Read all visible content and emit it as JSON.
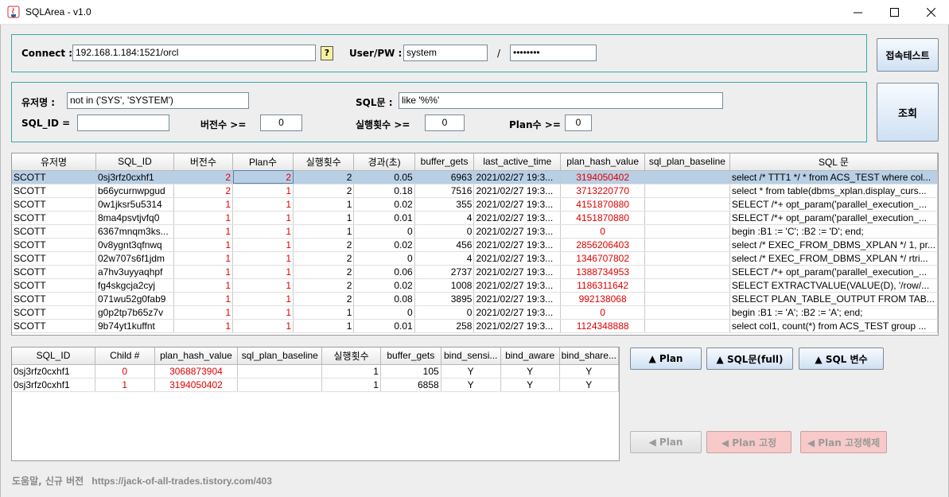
{
  "window": {
    "title": "SQLArea - v1.0"
  },
  "connect": {
    "label": "Connect :",
    "value": "192.168.1.184:1521/orcl",
    "help": "?",
    "user_label": "User/PW :",
    "user": "system",
    "sep": "/",
    "password": "••••••••",
    "test_button": "접속테스트"
  },
  "filter": {
    "user_label": "유저명 :",
    "user_value": "not in ('SYS', 'SYSTEM')",
    "sql_label": "SQL문 :",
    "sql_value": "like '%%'",
    "sqlid_label": "SQL_ID  =",
    "sqlid_value": "",
    "version_label": "버전수 >=",
    "version_value": "0",
    "exec_label": "실행횟수 >=",
    "exec_value": "0",
    "plan_label": "Plan수 >=",
    "plan_value": "0",
    "search_button": "조회"
  },
  "main_table": {
    "headers": [
      "유저명",
      "SQL_ID",
      "버전수",
      "Plan수",
      "실행횟수",
      "경과(초)",
      "buffer_gets",
      "last_active_time",
      "plan_hash_value",
      "sql_plan_baseline",
      "SQL 문"
    ],
    "rows": [
      [
        "SCOTT",
        "0sj3rfz0cxhf1",
        "2",
        "2",
        "2",
        "0.05",
        "6963",
        "2021/02/27 19:3...",
        "3194050402",
        "",
        "select /* TTT1 */ * from ACS_TEST where col..."
      ],
      [
        "SCOTT",
        "b66ycurnwpgud",
        "2",
        "1",
        "2",
        "0.18",
        "7516",
        "2021/02/27 19:3...",
        "3713220770",
        "",
        "select * from table(dbms_xplan.display_curs..."
      ],
      [
        "SCOTT",
        "0w1jksr5u5314",
        "1",
        "1",
        "1",
        "0.02",
        "355",
        "2021/02/27 19:3...",
        "4151870880",
        "",
        "SELECT /*+ opt_param('parallel_execution_..."
      ],
      [
        "SCOTT",
        "8ma4psvtjvfq0",
        "1",
        "1",
        "1",
        "0.01",
        "4",
        "2021/02/27 19:3...",
        "4151870880",
        "",
        "SELECT /*+ opt_param('parallel_execution_..."
      ],
      [
        "SCOTT",
        "6367mnqm3ks...",
        "1",
        "1",
        "1",
        "0",
        "0",
        "2021/02/27 19:3...",
        "0",
        "",
        "begin :B1 := 'C'; :B2 := 'D'; end;"
      ],
      [
        "SCOTT",
        "0v8ygnt3qfnwq",
        "1",
        "1",
        "2",
        "0.02",
        "456",
        "2021/02/27 19:3...",
        "2856206403",
        "",
        "select /* EXEC_FROM_DBMS_XPLAN */ 1, pr..."
      ],
      [
        "SCOTT",
        "02w707s6f1jdm",
        "1",
        "1",
        "2",
        "0",
        "4",
        "2021/02/27 19:3...",
        "1346707802",
        "",
        "select /* EXEC_FROM_DBMS_XPLAN */ rtri..."
      ],
      [
        "SCOTT",
        "a7hv3uyyaqhpf",
        "1",
        "1",
        "2",
        "0.06",
        "2737",
        "2021/02/27 19:3...",
        "1388734953",
        "",
        "SELECT /*+ opt_param('parallel_execution_..."
      ],
      [
        "SCOTT",
        "fg4skgcja2cyj",
        "1",
        "1",
        "2",
        "0.02",
        "1008",
        "2021/02/27 19:3...",
        "1186311642",
        "",
        "SELECT EXTRACTVALUE(VALUE(D), '/row/..."
      ],
      [
        "SCOTT",
        "071wu52g0fab9",
        "1",
        "1",
        "2",
        "0.08",
        "3895",
        "2021/02/27 19:3...",
        "992138068",
        "",
        "SELECT PLAN_TABLE_OUTPUT FROM TAB..."
      ],
      [
        "SCOTT",
        "g0p2tp7b65z7v",
        "1",
        "1",
        "1",
        "0",
        "0",
        "2021/02/27 19:3...",
        "0",
        "",
        "begin :B1 := 'A'; :B2 := 'A'; end;"
      ],
      [
        "SCOTT",
        "9b74yt1kuffnt",
        "1",
        "1",
        "1",
        "0.01",
        "258",
        "2021/02/27 19:3...",
        "1124348888",
        "",
        "select col1, count(*) from ACS_TEST group ..."
      ]
    ]
  },
  "child_table": {
    "headers": [
      "SQL_ID",
      "Child #",
      "plan_hash_value",
      "sql_plan_baseline",
      "실행횟수",
      "buffer_gets",
      "bind_sensi...",
      "bind_aware",
      "bind_share..."
    ],
    "rows": [
      [
        "0sj3rfz0cxhf1",
        "0",
        "3068873904",
        "",
        "1",
        "105",
        "Y",
        "Y",
        "Y"
      ],
      [
        "0sj3rfz0cxhf1",
        "1",
        "3194050402",
        "",
        "1",
        "6858",
        "Y",
        "Y",
        "Y"
      ]
    ]
  },
  "buttons": {
    "plan": "▲ Plan",
    "sql_full": "▲ SQL문(full)",
    "sql_var": "▲ SQL 변수",
    "plan_back": "◀ Plan",
    "plan_fix": "◀ Plan 고정",
    "plan_unfix": "◀ Plan 고정해제"
  },
  "footer": {
    "label": "도움말, 신규 버전",
    "url": "https://jack-of-all-trades.tistory.com/403"
  }
}
